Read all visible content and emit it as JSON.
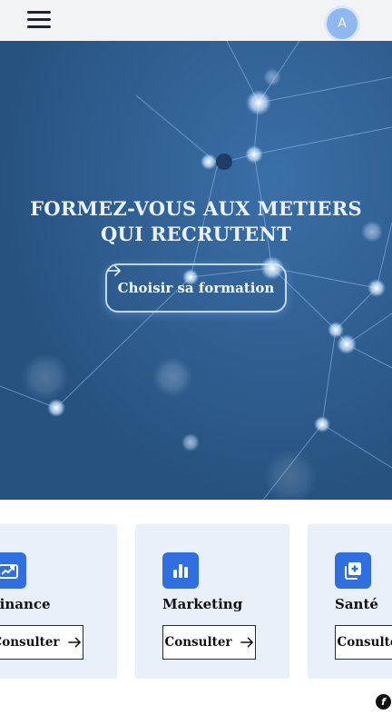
{
  "header": {
    "menu_icon": "hamburger-icon",
    "avatar_initial": "A",
    "avatar_color": "#8fb8f0"
  },
  "hero": {
    "title_line1": "FORMEZ-VOUS AUX METIERS",
    "title_line2": "QUI RECRUTENT",
    "cta_label": "Choisir sa formation",
    "cta_icon": "arrow-right-icon",
    "background_color": "#2f5d93"
  },
  "categories": [
    {
      "name": "Finance",
      "icon": "finance-chart-icon",
      "button_label": "Consulter"
    },
    {
      "name": "Marketing",
      "icon": "bar-chart-icon",
      "button_label": "Consulter"
    },
    {
      "name": "Santé",
      "icon": "medical-plus-icon",
      "button_label": "Consulter"
    }
  ],
  "accent_color": "#2f6fe0",
  "footer": {
    "badge_icon": "brand-logo-icon"
  }
}
